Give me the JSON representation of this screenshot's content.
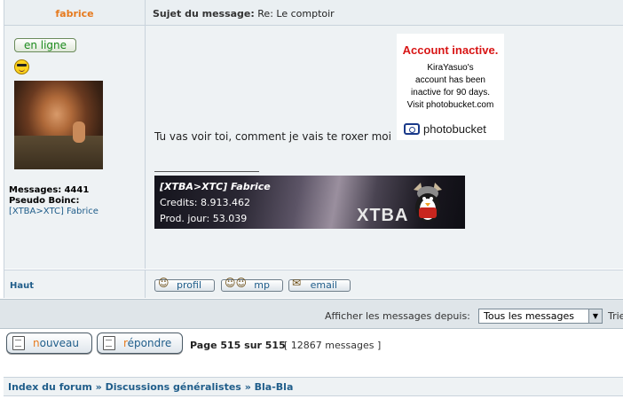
{
  "post": {
    "author": "fabrice",
    "subject_label": "Sujet du message:",
    "subject_value": "Re: Le comptoir",
    "online_badge": "en ligne",
    "stats": {
      "messages_label": "Messages:",
      "messages_value": "4441",
      "pseudo_label": "Pseudo Boinc:",
      "pseudo_value": "[XTBA>XTC] Fabrice"
    },
    "message_text": "Tu vas voir toi, comment je vais te roxer moi",
    "photobucket": {
      "title": "Account inactive.",
      "line1": "KiraYasuo's",
      "line2": "account has been",
      "line3": "inactive for 90 days.",
      "line4": "Visit photobucket.com",
      "logo_text": "photobucket"
    },
    "signature": {
      "name": "[XTBA>XTC] Fabrice",
      "credits": "Credits: 8.913.462",
      "prod": "Prod. jour: 53.039",
      "brand": "XTBA"
    },
    "footer": {
      "top_link": "Haut",
      "profile_label": "profil",
      "pm_label": "mp",
      "email_label": "email"
    }
  },
  "filter": {
    "label": "Afficher les messages depuis:",
    "selected": "Tous les messages",
    "trailing": "Trie"
  },
  "actions": {
    "new_prefix": "n",
    "new_rest": "ouveau",
    "reply_prefix": "r",
    "reply_rest": "épondre",
    "page_info": "Page 515 sur 515",
    "message_count": "[ 12867 messages ]"
  },
  "breadcrumb": {
    "item1": "Index du forum",
    "sep": "»",
    "item2": "Discussions généralistes",
    "item3": "Bla-Bla"
  },
  "colors": {
    "author": "#e67a1e",
    "link": "#1f5d8a",
    "online": "#1c8a1c",
    "photobucket_alert": "#d81515"
  }
}
